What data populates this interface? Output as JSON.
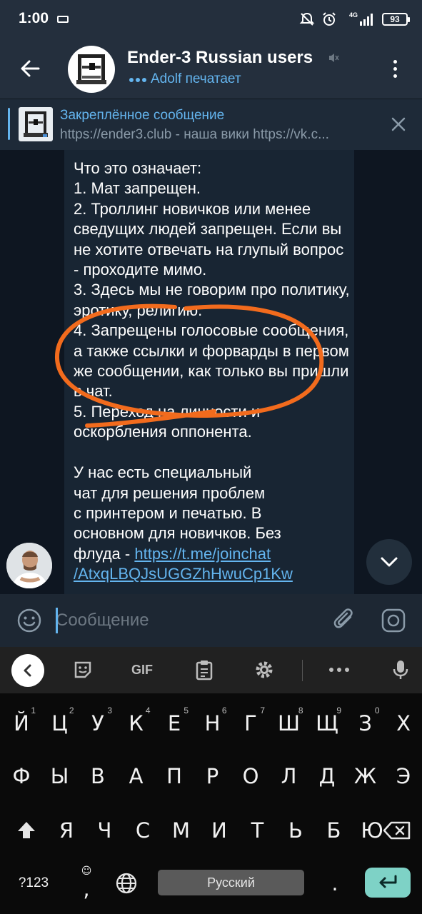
{
  "status_bar": {
    "time": "1:00",
    "battery": "93",
    "network": "4G"
  },
  "header": {
    "title": "Ender-3 Russian users",
    "status": "Adolf печатает",
    "icons": {
      "back": "arrow-left",
      "mute": "speaker-muted",
      "menu": "vertical-dots"
    }
  },
  "pinned": {
    "title": "Закреплённое сообщение",
    "text": "https://ender3.club - наша вики https://vk.c..."
  },
  "message": {
    "text": "Что это означает:\n1. Мат запрещен.\n2. Троллинг новичков или менее сведущих людей запрещен. Если вы не хотите отвечать на глупый вопрос - проходите мимо.\n3. Здесь мы не говорим про политику, эротику, религию.\n4. Запрещены голосовые сообщения, а также ссылки и форварды в первом же сообщении, как только вы пришли в чат.\n5. Переход на личности и оскорбления оппонента.\n\nУ нас есть специальный\nчат для решения проблем\nс принтером и печатью. В\nосновном для новичков. Без\nфлуда - ",
    "link": "https://t.me/joinchat\n/AtxqLBQJsUGGZhHwuCp1Kw"
  },
  "input": {
    "placeholder": "Сообщение"
  },
  "keyboard": {
    "toolbar": [
      "sticker-icon",
      "GIF",
      "clipboard-icon",
      "gear-icon",
      "more-icon",
      "mic-icon"
    ],
    "gif_label": "GIF",
    "row1": [
      {
        "k": "Й",
        "h": "1"
      },
      {
        "k": "Ц",
        "h": "2"
      },
      {
        "k": "У",
        "h": "3"
      },
      {
        "k": "К",
        "h": "4"
      },
      {
        "k": "Е",
        "h": "5"
      },
      {
        "k": "Н",
        "h": "6"
      },
      {
        "k": "Г",
        "h": "7"
      },
      {
        "k": "Ш",
        "h": "8"
      },
      {
        "k": "Щ",
        "h": "9"
      },
      {
        "k": "З",
        "h": "0"
      },
      {
        "k": "Х",
        "h": ""
      }
    ],
    "row2": [
      "Ф",
      "Ы",
      "В",
      "А",
      "П",
      "Р",
      "О",
      "Л",
      "Д",
      "Ж",
      "Э"
    ],
    "row3": [
      "Я",
      "Ч",
      "С",
      "М",
      "И",
      "Т",
      "Ь",
      "Б",
      "Ю"
    ],
    "symbols_label": "?123",
    "comma": ",",
    "period": ".",
    "space_label": "Русский"
  },
  "colors": {
    "accent": "#64b5ef",
    "annotation": "#f26b1d",
    "enter": "#7ed2c6"
  }
}
